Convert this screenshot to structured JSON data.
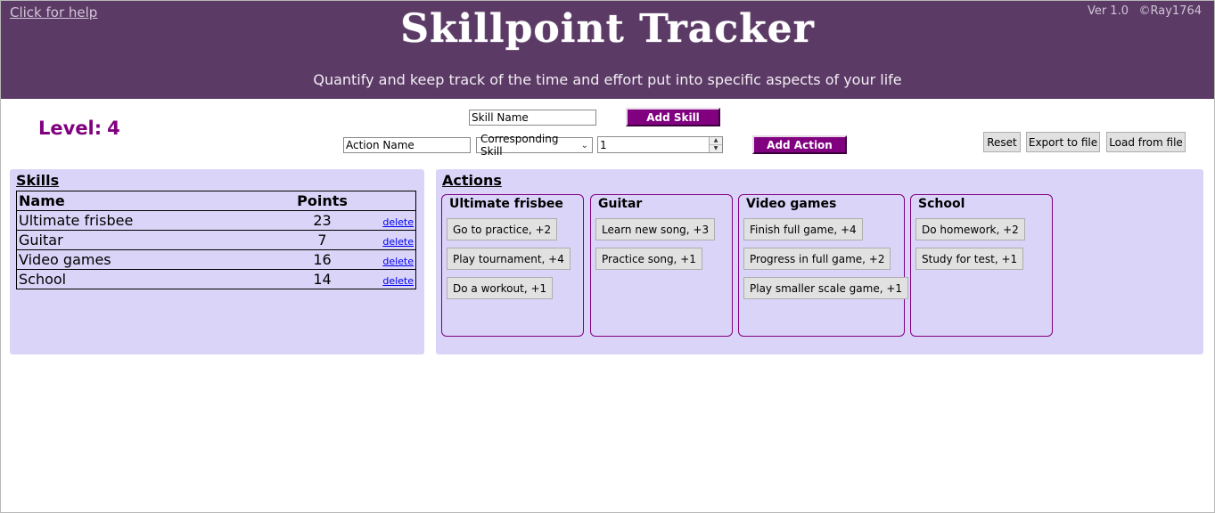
{
  "header": {
    "help_link": "Click for help",
    "title": "Skillpoint Tracker",
    "subtitle": "Quantify and keep track of the time and effort put into specific aspects of your life",
    "version": "Ver 1.0",
    "copyright": "©Ray1764",
    "background_color": "#5c3a66"
  },
  "level": {
    "label": "Level:",
    "value": "4"
  },
  "skill_form": {
    "name_value": "Skill Name",
    "add_label": "Add Skill"
  },
  "action_form": {
    "name_value": "Action Name",
    "skill_select_value": "Corresponding Skill",
    "points_value": "1",
    "add_label": "Add Action"
  },
  "file_controls": {
    "reset": "Reset",
    "export": "Export to file",
    "load": "Load from file"
  },
  "skills_panel": {
    "title": "Skills",
    "columns": [
      "Name",
      "Points"
    ],
    "delete_label": "delete",
    "rows": [
      {
        "name": "Ultimate frisbee",
        "points": "23"
      },
      {
        "name": "Guitar",
        "points": "7"
      },
      {
        "name": "Video games",
        "points": "16"
      },
      {
        "name": "School",
        "points": "14"
      }
    ]
  },
  "actions_panel": {
    "title": "Actions",
    "groups": [
      {
        "skill": "Ultimate frisbee",
        "actions": [
          "Go to practice, +2",
          "Play tournament, +4",
          "Do a workout, +1"
        ]
      },
      {
        "skill": "Guitar",
        "actions": [
          "Learn new song, +3",
          "Practice song, +1"
        ]
      },
      {
        "skill": "Video games",
        "actions": [
          "Finish full game, +4",
          "Progress in full game, +2",
          "Play smaller scale game, +1"
        ]
      },
      {
        "skill": "School",
        "actions": [
          "Do homework, +2",
          "Study for test, +1"
        ]
      }
    ]
  },
  "colors": {
    "accent": "#800080",
    "panel_bg": "#dad4f8"
  }
}
